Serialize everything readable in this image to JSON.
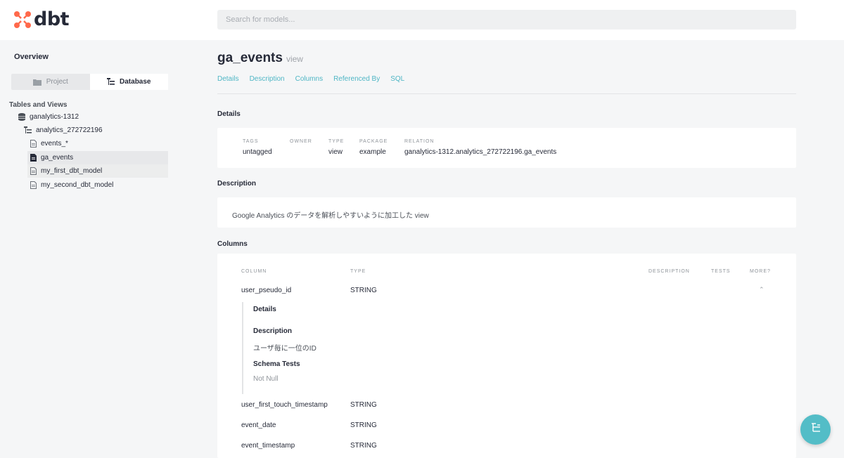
{
  "app": {
    "logo_text": "dbt"
  },
  "search": {
    "placeholder": "Search for models..."
  },
  "sidebar": {
    "overview": "Overview",
    "tabs": [
      {
        "label": "Project",
        "icon": "folder-icon",
        "active": false
      },
      {
        "label": "Database",
        "icon": "tree-icon",
        "active": true
      }
    ],
    "section_title": "Tables and Views",
    "tree": {
      "database": "ganalytics-1312",
      "schema": "analytics_272722196",
      "items": [
        {
          "label": "events_*",
          "selected": false
        },
        {
          "label": "ga_events",
          "selected": true
        },
        {
          "label": "my_first_dbt_model",
          "selected": false
        },
        {
          "label": "my_second_dbt_model",
          "selected": false
        }
      ]
    }
  },
  "main": {
    "title": "ga_events",
    "title_sub": "view",
    "nav": [
      "Details",
      "Description",
      "Columns",
      "Referenced By",
      "SQL"
    ],
    "details": {
      "heading": "Details",
      "fields": [
        {
          "label": "TAGS",
          "value": "untagged"
        },
        {
          "label": "OWNER",
          "value": ""
        },
        {
          "label": "TYPE",
          "value": "view"
        },
        {
          "label": "PACKAGE",
          "value": "example"
        },
        {
          "label": "RELATION",
          "value": "ganalytics-1312.analytics_272722196.ga_events"
        }
      ]
    },
    "description": {
      "heading": "Description",
      "text": "Google Analytics のデータを解析しやすいように加工した view"
    },
    "columns": {
      "heading": "Columns",
      "headers": {
        "column": "COLUMN",
        "type": "TYPE",
        "description": "DESCRIPTION",
        "tests": "TESTS",
        "more": "MORE?"
      },
      "rows": [
        {
          "name": "user_pseudo_id",
          "type": "STRING"
        },
        {
          "name": "user_first_touch_timestamp",
          "type": "STRING"
        },
        {
          "name": "event_date",
          "type": "STRING"
        },
        {
          "name": "event_timestamp",
          "type": "STRING"
        }
      ],
      "expanded": {
        "details_heading": "Details",
        "description_heading": "Description",
        "description_text": "ユーザ毎に一位のID",
        "tests_heading": "Schema Tests",
        "tests_text": "Not Null"
      }
    }
  },
  "colors": {
    "accent": "#4fb6c5",
    "fab": "#53bdc7",
    "logo": "#ff694b"
  }
}
